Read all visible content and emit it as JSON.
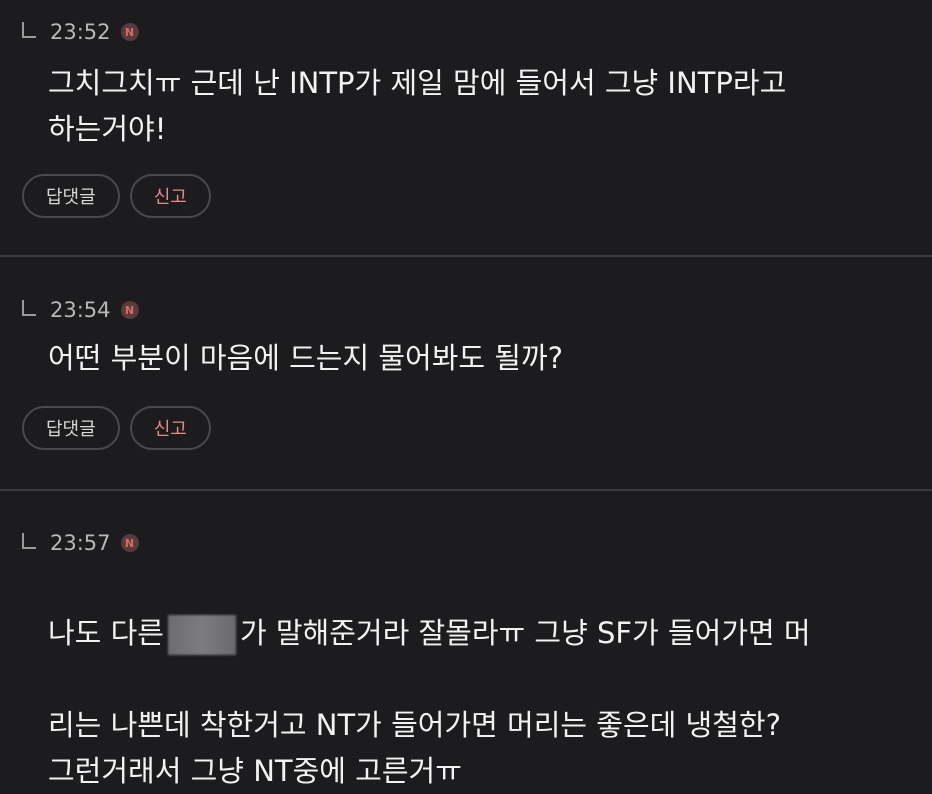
{
  "comments": [
    {
      "time": "23:52",
      "badge": "N",
      "text": "그치그치ㅠ 근데 난 INTP가 제일 맘에 들어서 그냥 INTP라고\n하는거야!",
      "reply_label": "답댓글",
      "report_label": "신고"
    },
    {
      "time": "23:54",
      "badge": "N",
      "text": "어떤 부분이 마음에 드는지 물어봐도 될까?",
      "reply_label": "답댓글",
      "report_label": "신고"
    },
    {
      "time": "23:57",
      "badge": "N",
      "text_before": "나도 다른",
      "text_after": "가 말해준거라 잘몰라ㅠ 그냥 SF가 들어가면 머",
      "text_rest": "리는 나쁜데 착한거고 NT가 들어가면 머리는 좋은데 냉철한?\n그런거래서 그냥 NT중에 고른거ㅠ"
    }
  ]
}
